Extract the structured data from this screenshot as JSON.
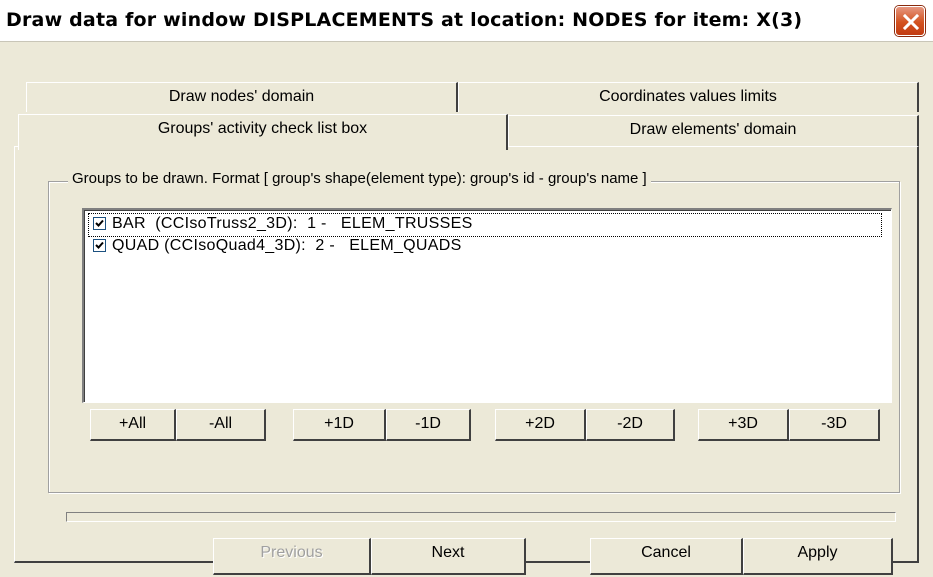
{
  "window": {
    "title": "Draw data for window DISPLACEMENTS at location: NODES for item: X(3)",
    "close_icon": "close-icon"
  },
  "tabs": {
    "back_row": [
      {
        "label": "Draw nodes' domain"
      },
      {
        "label": "Coordinates values limits"
      }
    ],
    "front_row": [
      {
        "label": "Groups' activity check list box",
        "active": true
      },
      {
        "label": "Draw elements' domain",
        "active": false
      }
    ]
  },
  "groups": {
    "legend": "Groups to be drawn. Format [ group's shape(element type): group's id - group's name ]",
    "items": [
      {
        "label": "BAR  (CCIsoTruss2_3D):  1 -   ELEM_TRUSSES",
        "checked": true
      },
      {
        "label": "QUAD (CCIsoQuad4_3D):  2 -   ELEM_QUADS",
        "checked": true
      }
    ],
    "filter_buttons": [
      "+All",
      "-All",
      "+1D",
      "-1D",
      "+2D",
      "-2D",
      "+3D",
      "-3D"
    ]
  },
  "progress": {
    "value": 0
  },
  "actions": {
    "previous": "Previous",
    "next": "Next",
    "cancel": "Cancel",
    "apply": "Apply"
  },
  "colors": {
    "dialog_bg": "#ece9d8",
    "close_button": "#d3521f"
  }
}
